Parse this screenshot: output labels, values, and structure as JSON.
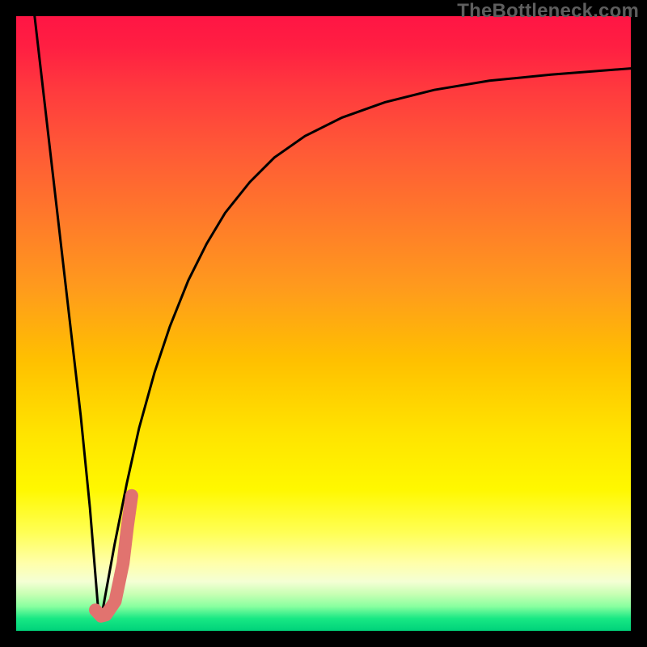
{
  "watermark": "TheBottleneck.com",
  "colors": {
    "stroke_main": "#000000",
    "stroke_accent": "#e1736f",
    "gradient_top": "#ff1544",
    "gradient_bottom": "#00d27a"
  },
  "chart_data": {
    "type": "line",
    "title": "",
    "xlabel": "",
    "ylabel": "",
    "xlim": [
      0,
      100
    ],
    "ylim": [
      0,
      100
    ],
    "grid": false,
    "legend": false,
    "series": [
      {
        "name": "left-branch",
        "x": [
          3.0,
          4.5,
          6.0,
          7.5,
          9.0,
          10.5,
          12.0,
          13.3
        ],
        "y": [
          100,
          87,
          74,
          61,
          48,
          35,
          20,
          4
        ]
      },
      {
        "name": "right-branch",
        "x": [
          14.0,
          16.0,
          18.0,
          20.0,
          22.5,
          25.0,
          28.0,
          31.0,
          34.0,
          38.0,
          42.0,
          47.0,
          53.0,
          60.0,
          68.0,
          77.0,
          87.0,
          100.0
        ],
        "y": [
          3.0,
          14.0,
          24.0,
          33.0,
          42.0,
          49.5,
          57.0,
          63.0,
          68.0,
          73.0,
          77.0,
          80.5,
          83.5,
          86.0,
          88.0,
          89.5,
          90.5,
          91.5
        ]
      },
      {
        "name": "j-hook-highlight",
        "x": [
          12.9,
          13.8,
          14.6,
          16.1,
          17.4,
          18.1,
          18.8
        ],
        "y": [
          3.4,
          2.4,
          2.6,
          4.8,
          11.0,
          17.0,
          22.0
        ]
      }
    ]
  }
}
